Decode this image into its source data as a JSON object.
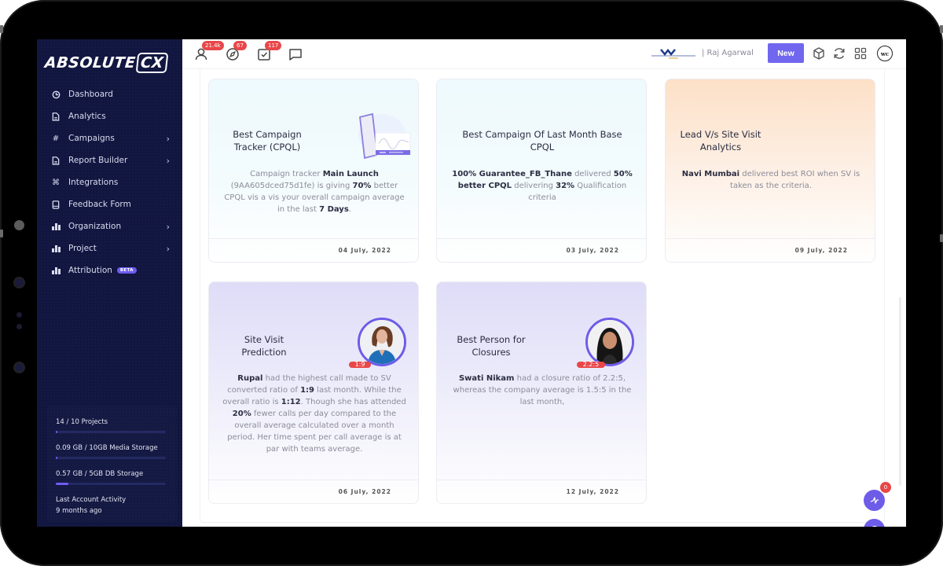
{
  "app": {
    "logo_main": "ABSOLUTE",
    "logo_accent": "CX"
  },
  "sidebar": {
    "items": [
      {
        "label": "Dashboard",
        "icon": "clock-pie-icon",
        "has_submenu": false
      },
      {
        "label": "Analytics",
        "icon": "document-icon",
        "has_submenu": false
      },
      {
        "label": "Campaigns",
        "icon": "hash-icon",
        "has_submenu": true
      },
      {
        "label": "Report Builder",
        "icon": "document-icon",
        "has_submenu": true
      },
      {
        "label": "Integrations",
        "icon": "command-icon",
        "has_submenu": false
      },
      {
        "label": "Feedback Form",
        "icon": "tablet-icon",
        "has_submenu": false
      },
      {
        "label": "Organization",
        "icon": "bar-chart-icon",
        "has_submenu": true
      },
      {
        "label": "Project",
        "icon": "bar-chart-icon",
        "has_submenu": true
      },
      {
        "label": "Attribution",
        "icon": "bar-chart-icon",
        "has_submenu": false,
        "badge": "BETA"
      }
    ],
    "usage": [
      {
        "label": "14 / 10 Projects",
        "fill": 0.01
      },
      {
        "label": "0.09 GB / 10GB Media Storage",
        "fill": 0.01
      },
      {
        "label": "0.57 GB / 5GB DB Storage",
        "fill": 0.114
      }
    ],
    "activity_label": "Last Account Activity",
    "activity_value": "9 months ago"
  },
  "topbar": {
    "icons": [
      {
        "name": "user-icon",
        "badge": "21.4k"
      },
      {
        "name": "compass-icon",
        "badge": "67"
      },
      {
        "name": "task-check-icon",
        "badge": "117"
      },
      {
        "name": "chat-icon",
        "badge": null
      }
    ],
    "user_name": "| Raj Agarwal",
    "new_button": "New",
    "avatar_initials": "wc"
  },
  "cards": [
    {
      "title": "Best Campaign Tracker (CPQL)",
      "title_lines": [
        "Best Campaign",
        "Tracker (CPQL)"
      ],
      "body": [
        {
          "t": "Campaign tracker ",
          "b": false
        },
        {
          "t": "Main Launch",
          "b": true
        },
        {
          "t": " (9AA605dced75d1fe) is giving ",
          "b": false
        },
        {
          "t": "70%",
          "b": true
        },
        {
          "t": " better CPQL vis a vis your overall campaign average in the last ",
          "b": false
        },
        {
          "t": "7 Days",
          "b": true
        },
        {
          "t": ".",
          "b": false
        }
      ],
      "date": "04 July, 2022",
      "theme": "cyan"
    },
    {
      "title": "Best Campaign Of Last Month Base CPQL",
      "title_lines": [
        "Best Campaign Of Last Month Base",
        "CPQL"
      ],
      "body": [
        {
          "t": "100% Guarantee_FB_Thane",
          "b": true
        },
        {
          "t": " delivered ",
          "b": false
        },
        {
          "t": "50% better CPQL",
          "b": true
        },
        {
          "t": " delivering ",
          "b": false
        },
        {
          "t": "32%",
          "b": true
        },
        {
          "t": " Qualification criteria",
          "b": false
        }
      ],
      "date": "03 July, 2022",
      "theme": "cyan"
    },
    {
      "title": "Lead V/s Site Visit Analytics",
      "title_lines": [
        "Lead V/s Site Visit",
        "Analytics"
      ],
      "body": [
        {
          "t": "Navi Mumbai",
          "b": true
        },
        {
          "t": " delivered best ROI when SV is taken as the criteria.",
          "b": false
        }
      ],
      "date": "09 July, 2022",
      "theme": "peach"
    },
    {
      "title": "Site Visit Prediction",
      "title_lines": [
        "Site Visit",
        "Prediction"
      ],
      "body": [
        {
          "t": "Rupal",
          "b": true
        },
        {
          "t": " had the highest call made to SV converted ratio of ",
          "b": false
        },
        {
          "t": "1:9",
          "b": true
        },
        {
          "t": " last month. While the overall ratio is ",
          "b": false
        },
        {
          "t": "1:12",
          "b": true
        },
        {
          "t": ". Though she has attended ",
          "b": false
        },
        {
          "t": "20%",
          "b": true
        },
        {
          "t": " fewer calls per day compared to the overall average calculated over a month period. Her time spent per call average is at par with teams average.",
          "b": false
        }
      ],
      "date": "06 July, 2022",
      "theme": "lav",
      "ratio_badge": "1:9",
      "person": "Rupal"
    },
    {
      "title": "Best Person for Closures",
      "title_lines": [
        "Best Person for",
        "Closures"
      ],
      "body": [
        {
          "t": "Swati Nikam",
          "b": true
        },
        {
          "t": " had a closure ratio of 2.2:5, whereas the company average is 1.5:5 in the last month,",
          "b": false
        }
      ],
      "date": "12 July, 2022",
      "theme": "lav",
      "ratio_badge": "2.2:5",
      "person": "Swati Nikam"
    }
  ],
  "fabs": {
    "activity_badge": "0"
  },
  "colors": {
    "sidebar_bg": "#111640",
    "accent": "#6d5ce8",
    "badge_red": "#e8474a",
    "new_button": "#7166ee"
  }
}
